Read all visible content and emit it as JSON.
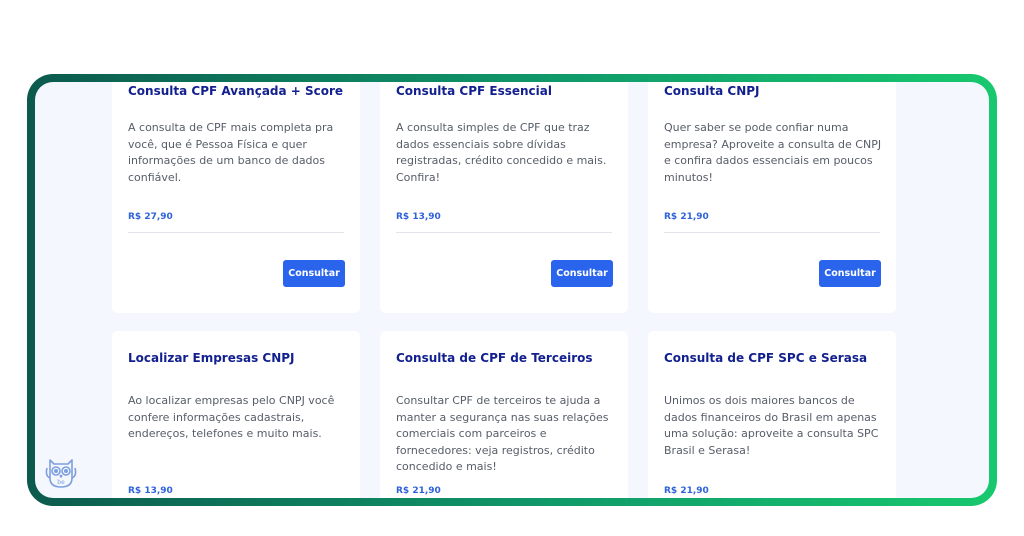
{
  "cards": [
    {
      "title": "Consulta CPF Avançada + Score",
      "description": "A consulta de CPF mais completa pra você, que é Pessoa Física e quer informações de um banco de dados confiável.",
      "price": "R$ 27,90",
      "button": "Consultar"
    },
    {
      "title": "Consulta CPF Essencial",
      "description": "A consulta simples de CPF que traz dados essenciais sobre dívidas registradas, crédito concedido e mais. Confira!",
      "price": "R$ 13,90",
      "button": "Consultar"
    },
    {
      "title": "Consulta CNPJ",
      "description": "Quer saber se pode confiar numa empresa? Aproveite a consulta de CNPJ e confira dados essenciais em poucos minutos!",
      "price": "R$ 21,90",
      "button": "Consultar"
    },
    {
      "title": "Localizar Empresas CNPJ",
      "description": "Ao localizar empresas pelo CNPJ você confere informações cadastrais, endereços, telefones e muito mais.",
      "price": "R$ 13,90"
    },
    {
      "title": "Consulta de CPF de Terceiros",
      "description": "Consultar CPF de terceiros te ajuda a manter a segurança nas suas relações comerciais com parceiros e fornecedores: veja registros, crédito concedido e mais!",
      "price": "R$ 21,90"
    },
    {
      "title": "Consulta de CPF SPC e Serasa",
      "description": "Unimos os dois maiores bancos de dados financeiros do Brasil em apenas uma solução: aproveite a consulta SPC Brasil e Serasa!",
      "price": "R$ 21,90"
    }
  ],
  "assistant": {
    "icon": "owl-icon",
    "label": "be"
  },
  "colors": {
    "title": "#121f8e",
    "price": "#2f62d9",
    "button": "#2a64ec",
    "frame_start": "#0c5a4e",
    "frame_end": "#18c86e",
    "screen_bg": "#f4f7fd"
  }
}
